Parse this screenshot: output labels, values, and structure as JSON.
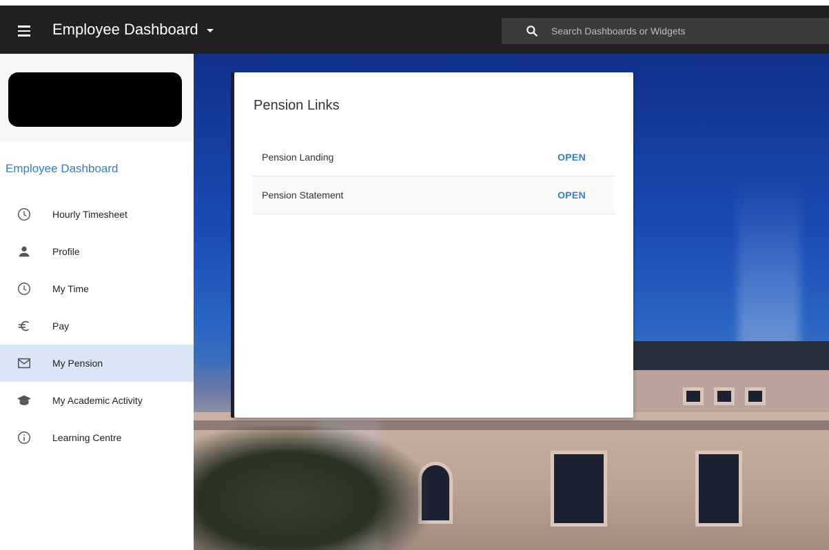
{
  "header": {
    "app_title": "Employee Dashboard",
    "search_placeholder": "Search Dashboards or Widgets"
  },
  "sidebar": {
    "title": "Employee Dashboard",
    "items": [
      {
        "label": "Hourly Timesheet",
        "icon": "clock-icon"
      },
      {
        "label": "Profile",
        "icon": "person-icon"
      },
      {
        "label": "My Time",
        "icon": "clock-icon"
      },
      {
        "label": "Pay",
        "icon": "euro-icon"
      },
      {
        "label": "My Pension",
        "icon": "mail-icon",
        "active": true
      },
      {
        "label": "My Academic Activity",
        "icon": "graduation-cap-icon"
      },
      {
        "label": "Learning Centre",
        "icon": "info-icon"
      }
    ]
  },
  "card": {
    "title": "Pension Links",
    "links": [
      {
        "label": "Pension Landing",
        "action": "OPEN"
      },
      {
        "label": "Pension Statement",
        "action": "OPEN"
      }
    ]
  },
  "colors": {
    "topbar": "#212121",
    "accent": "#2f7ed1",
    "active_item_bg": "#d8e6f5"
  }
}
